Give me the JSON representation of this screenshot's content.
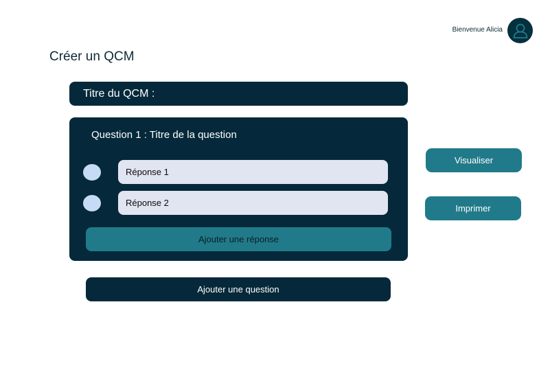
{
  "header": {
    "welcome_text": "Bienvenue Alicia",
    "avatar_icon": "user-icon"
  },
  "page": {
    "title": "Créer un QCM"
  },
  "qcm": {
    "title_label": "Titre du QCM :",
    "question": {
      "title": "Question 1 : Titre de la question",
      "answers": [
        {
          "label": "Réponse 1"
        },
        {
          "label": "Réponse 2"
        }
      ],
      "add_answer_label": "Ajouter une réponse"
    },
    "add_question_label": "Ajouter une question"
  },
  "actions": {
    "preview_label": "Visualiser",
    "print_label": "Imprimer"
  },
  "colors": {
    "dark_navy": "#05293a",
    "teal": "#217a8a",
    "input_bg": "#e1e4f1",
    "radio_bg": "#c6dcf6"
  }
}
